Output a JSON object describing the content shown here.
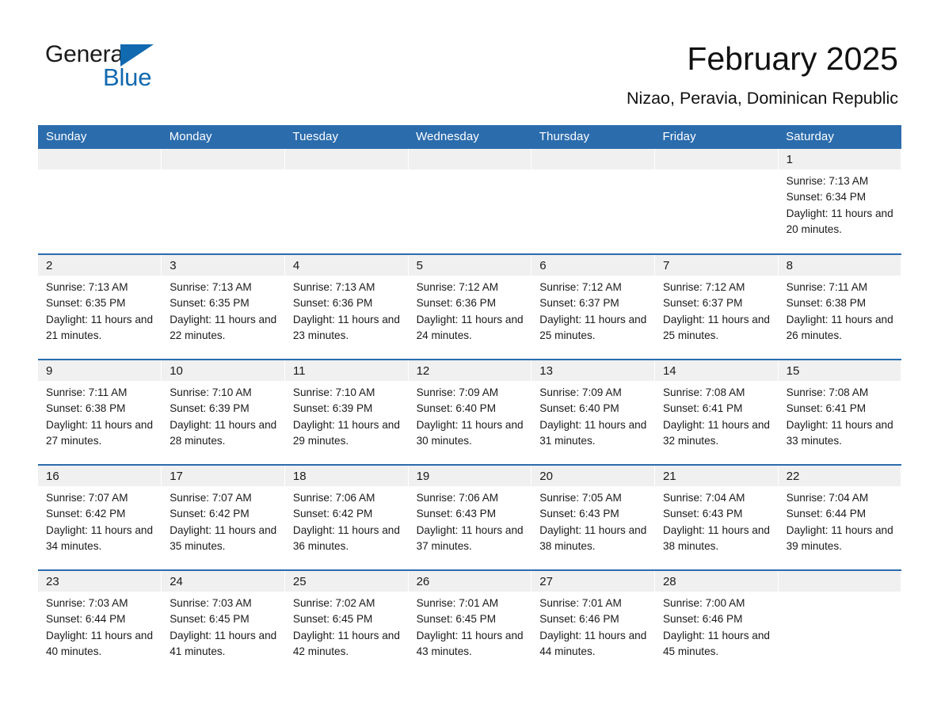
{
  "brand": {
    "name_part1": "General",
    "name_part2": "Blue",
    "logo_icon": "triangle-flag-icon",
    "accent_color": "#1169b0"
  },
  "header": {
    "month_title": "February 2025",
    "location": "Nizao, Peravia, Dominican Republic"
  },
  "theme": {
    "header_blue": "#2b6cad",
    "daynum_band_gray": "#f0f0f0",
    "cell_white": "#ffffff",
    "text_black": "#1a1a1a"
  },
  "calendar": {
    "columns": [
      "Sunday",
      "Monday",
      "Tuesday",
      "Wednesday",
      "Thursday",
      "Friday",
      "Saturday"
    ],
    "weeks": [
      [
        {
          "day": "",
          "lines": []
        },
        {
          "day": "",
          "lines": []
        },
        {
          "day": "",
          "lines": []
        },
        {
          "day": "",
          "lines": []
        },
        {
          "day": "",
          "lines": []
        },
        {
          "day": "",
          "lines": []
        },
        {
          "day": "1",
          "sunrise": "Sunrise: 7:13 AM",
          "sunset": "Sunset: 6:34 PM",
          "daylight": "Daylight: 11 hours and 20 minutes."
        }
      ],
      [
        {
          "day": "2",
          "sunrise": "Sunrise: 7:13 AM",
          "sunset": "Sunset: 6:35 PM",
          "daylight": "Daylight: 11 hours and 21 minutes."
        },
        {
          "day": "3",
          "sunrise": "Sunrise: 7:13 AM",
          "sunset": "Sunset: 6:35 PM",
          "daylight": "Daylight: 11 hours and 22 minutes."
        },
        {
          "day": "4",
          "sunrise": "Sunrise: 7:13 AM",
          "sunset": "Sunset: 6:36 PM",
          "daylight": "Daylight: 11 hours and 23 minutes."
        },
        {
          "day": "5",
          "sunrise": "Sunrise: 7:12 AM",
          "sunset": "Sunset: 6:36 PM",
          "daylight": "Daylight: 11 hours and 24 minutes."
        },
        {
          "day": "6",
          "sunrise": "Sunrise: 7:12 AM",
          "sunset": "Sunset: 6:37 PM",
          "daylight": "Daylight: 11 hours and 25 minutes."
        },
        {
          "day": "7",
          "sunrise": "Sunrise: 7:12 AM",
          "sunset": "Sunset: 6:37 PM",
          "daylight": "Daylight: 11 hours and 25 minutes."
        },
        {
          "day": "8",
          "sunrise": "Sunrise: 7:11 AM",
          "sunset": "Sunset: 6:38 PM",
          "daylight": "Daylight: 11 hours and 26 minutes."
        }
      ],
      [
        {
          "day": "9",
          "sunrise": "Sunrise: 7:11 AM",
          "sunset": "Sunset: 6:38 PM",
          "daylight": "Daylight: 11 hours and 27 minutes."
        },
        {
          "day": "10",
          "sunrise": "Sunrise: 7:10 AM",
          "sunset": "Sunset: 6:39 PM",
          "daylight": "Daylight: 11 hours and 28 minutes."
        },
        {
          "day": "11",
          "sunrise": "Sunrise: 7:10 AM",
          "sunset": "Sunset: 6:39 PM",
          "daylight": "Daylight: 11 hours and 29 minutes."
        },
        {
          "day": "12",
          "sunrise": "Sunrise: 7:09 AM",
          "sunset": "Sunset: 6:40 PM",
          "daylight": "Daylight: 11 hours and 30 minutes."
        },
        {
          "day": "13",
          "sunrise": "Sunrise: 7:09 AM",
          "sunset": "Sunset: 6:40 PM",
          "daylight": "Daylight: 11 hours and 31 minutes."
        },
        {
          "day": "14",
          "sunrise": "Sunrise: 7:08 AM",
          "sunset": "Sunset: 6:41 PM",
          "daylight": "Daylight: 11 hours and 32 minutes."
        },
        {
          "day": "15",
          "sunrise": "Sunrise: 7:08 AM",
          "sunset": "Sunset: 6:41 PM",
          "daylight": "Daylight: 11 hours and 33 minutes."
        }
      ],
      [
        {
          "day": "16",
          "sunrise": "Sunrise: 7:07 AM",
          "sunset": "Sunset: 6:42 PM",
          "daylight": "Daylight: 11 hours and 34 minutes."
        },
        {
          "day": "17",
          "sunrise": "Sunrise: 7:07 AM",
          "sunset": "Sunset: 6:42 PM",
          "daylight": "Daylight: 11 hours and 35 minutes."
        },
        {
          "day": "18",
          "sunrise": "Sunrise: 7:06 AM",
          "sunset": "Sunset: 6:42 PM",
          "daylight": "Daylight: 11 hours and 36 minutes."
        },
        {
          "day": "19",
          "sunrise": "Sunrise: 7:06 AM",
          "sunset": "Sunset: 6:43 PM",
          "daylight": "Daylight: 11 hours and 37 minutes."
        },
        {
          "day": "20",
          "sunrise": "Sunrise: 7:05 AM",
          "sunset": "Sunset: 6:43 PM",
          "daylight": "Daylight: 11 hours and 38 minutes."
        },
        {
          "day": "21",
          "sunrise": "Sunrise: 7:04 AM",
          "sunset": "Sunset: 6:43 PM",
          "daylight": "Daylight: 11 hours and 38 minutes."
        },
        {
          "day": "22",
          "sunrise": "Sunrise: 7:04 AM",
          "sunset": "Sunset: 6:44 PM",
          "daylight": "Daylight: 11 hours and 39 minutes."
        }
      ],
      [
        {
          "day": "23",
          "sunrise": "Sunrise: 7:03 AM",
          "sunset": "Sunset: 6:44 PM",
          "daylight": "Daylight: 11 hours and 40 minutes."
        },
        {
          "day": "24",
          "sunrise": "Sunrise: 7:03 AM",
          "sunset": "Sunset: 6:45 PM",
          "daylight": "Daylight: 11 hours and 41 minutes."
        },
        {
          "day": "25",
          "sunrise": "Sunrise: 7:02 AM",
          "sunset": "Sunset: 6:45 PM",
          "daylight": "Daylight: 11 hours and 42 minutes."
        },
        {
          "day": "26",
          "sunrise": "Sunrise: 7:01 AM",
          "sunset": "Sunset: 6:45 PM",
          "daylight": "Daylight: 11 hours and 43 minutes."
        },
        {
          "day": "27",
          "sunrise": "Sunrise: 7:01 AM",
          "sunset": "Sunset: 6:46 PM",
          "daylight": "Daylight: 11 hours and 44 minutes."
        },
        {
          "day": "28",
          "sunrise": "Sunrise: 7:00 AM",
          "sunset": "Sunset: 6:46 PM",
          "daylight": "Daylight: 11 hours and 45 minutes."
        },
        {
          "day": "",
          "lines": []
        }
      ]
    ]
  }
}
